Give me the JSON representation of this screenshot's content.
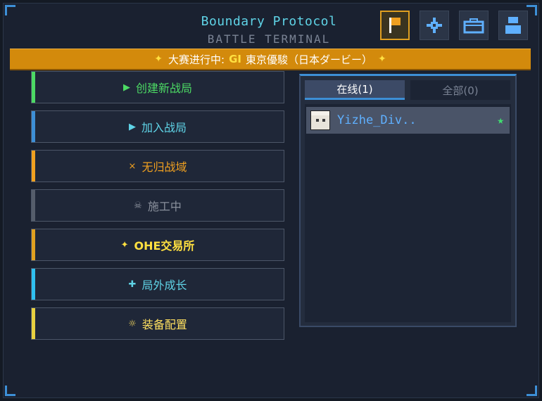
{
  "header": {
    "title": "Boundary Protocol",
    "subtitle": "BATTLE TERMINAL",
    "icons": [
      {
        "name": "flag-icon",
        "active": true
      },
      {
        "name": "crosshair-icon",
        "active": false
      },
      {
        "name": "briefcase-icon",
        "active": false
      },
      {
        "name": "stack-icon",
        "active": false
      }
    ]
  },
  "banner": {
    "prefix": "大赛进行中:",
    "highlight": "GI",
    "event": "東京優駿（日本ダービー）",
    "star": "✦"
  },
  "menu": [
    {
      "label": "创建新战局",
      "icon": "▶",
      "icon_name": "flag-play-icon",
      "color": "#4cd964",
      "text_color": "#4cd964"
    },
    {
      "label": "加入战局",
      "icon": "▶",
      "icon_name": "join-arrow-icon",
      "color": "#3d8fd6",
      "text_color": "#5fd3e6"
    },
    {
      "label": "无归战域",
      "icon": "⨯",
      "icon_name": "crossed-swords-icon",
      "color": "#f0a020",
      "text_color": "#f0a020"
    },
    {
      "label": "施工中",
      "icon": "☠",
      "icon_name": "skull-icon",
      "color": "#555d6b",
      "text_color": "#8a909c"
    },
    {
      "label": "OHE交易所",
      "icon": "✦",
      "icon_name": "sparkle-icon",
      "color": "#e0a020",
      "text_color": "#ffe040"
    },
    {
      "label": "局外成长",
      "icon": "✚",
      "icon_name": "plus-icon",
      "color": "#2fc0f0",
      "text_color": "#5fd3e6"
    },
    {
      "label": "装备配置",
      "icon": "☼",
      "icon_name": "gear-icon",
      "color": "#e8d040",
      "text_color": "#ffe060"
    }
  ],
  "players_panel": {
    "tab_online": "在线(1)",
    "tab_all": "全部(0)",
    "players": [
      {
        "name": "Yizhe_Div..",
        "status_icon": "star-icon",
        "status": "★"
      }
    ]
  },
  "colors": {
    "accent_blue": "#3d8fd6",
    "banner_orange": "#d38a0c",
    "title_cyan": "#5fd3e6"
  }
}
